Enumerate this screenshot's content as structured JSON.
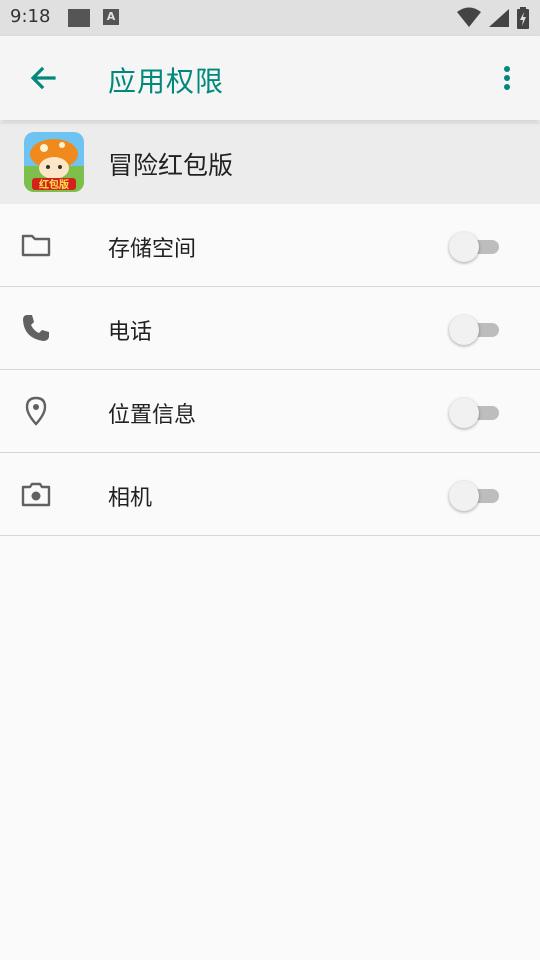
{
  "status_bar": {
    "time": "9:18",
    "notification_icons": [
      "square-icon",
      "a-icon"
    ],
    "a_icon_letter": "A",
    "right_icons": [
      "wifi-icon",
      "signal-icon",
      "battery-charging-icon"
    ]
  },
  "app_bar": {
    "title": "应用权限",
    "back_icon": "arrow-back-icon",
    "menu_icon": "more-vert-icon",
    "accent_color": "#00897b"
  },
  "app": {
    "name": "冒险红包版",
    "icon_text": "红包版"
  },
  "permissions": [
    {
      "label": "存储空间",
      "icon": "folder-icon",
      "enabled": false
    },
    {
      "label": "电话",
      "icon": "phone-icon",
      "enabled": false
    },
    {
      "label": "位置信息",
      "icon": "location-icon",
      "enabled": false
    },
    {
      "label": "相机",
      "icon": "camera-icon",
      "enabled": false
    }
  ]
}
